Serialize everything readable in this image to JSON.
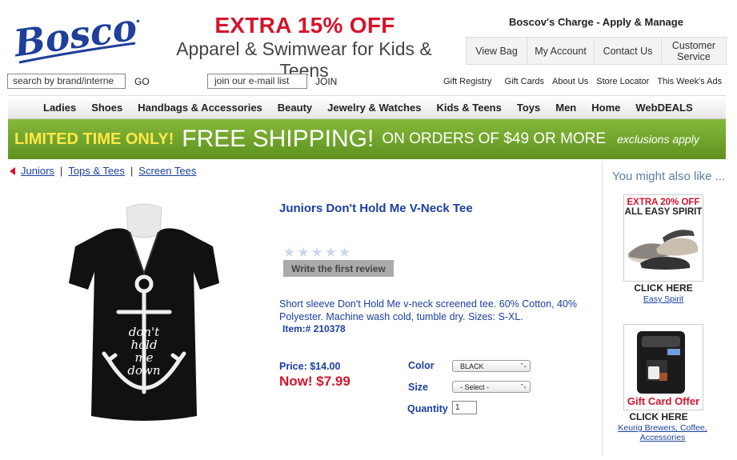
{
  "header": {
    "logo_text": "Boscov's",
    "promo_headline": "EXTRA 15% OFF",
    "promo_subline": "Apparel & Swimwear for Kids & Teens",
    "charge_link": "Boscov's Charge - Apply & Manage",
    "account_buttons": [
      "View Bag",
      "My Account",
      "Contact Us",
      "Customer Service"
    ],
    "search_value": "search by brand/interne",
    "go_label": "GO",
    "email_value": "join our e-mail list",
    "join_label": "JOIN",
    "utility_links": [
      "Gift Registry",
      "Gift Cards",
      "About Us",
      "Store Locator",
      "This Week's Ads"
    ]
  },
  "nav": {
    "items": [
      "Ladies",
      "Shoes",
      "Handbags & Accessories",
      "Beauty",
      "Jewelry & Watches",
      "Kids & Teens",
      "Toys",
      "Men",
      "Home",
      "WebDEALS"
    ]
  },
  "banner": {
    "limited": "LIMITED TIME ONLY!",
    "free_shipping": "FREE SHIPPING!",
    "orders": "ON ORDERS OF $49 OR MORE",
    "exclusions": "exclusions apply"
  },
  "breadcrumb": [
    "Juniors",
    "Tops & Tees",
    "Screen Tees"
  ],
  "breadcrumb_sep": "|",
  "product": {
    "title": "Juniors Don't Hold Me V-Neck Tee",
    "shirt_print": [
      "don't",
      "hold",
      "me",
      "down"
    ],
    "rating_stars": 0,
    "review_button": "Write the first review",
    "description": "Short sleeve Don't Hold Me v-neck screened tee. 60% Cotton, 40% Polyester. Machine wash cold, tumble dry. Sizes: S-XL.",
    "item_number": "Item:# 210378",
    "price": "Price: $14.00",
    "now_price": "Now! $7.99",
    "color_label": "Color",
    "color_value": "BLACK",
    "size_label": "Size",
    "size_value": "- Select -",
    "quantity_label": "Quantity",
    "quantity_value": "1"
  },
  "sidebar": {
    "heading": "You might also like ...",
    "ads": [
      {
        "headline1": "EXTRA 20% OFF",
        "headline2": "ALL EASY SPIRIT",
        "cta": "CLICK HERE",
        "link": "Easy Spirit"
      },
      {
        "headline1": "Gift Card Offer",
        "cta": "CLICK HERE",
        "link": "Keurig Brewers, Coffee, Accessories"
      }
    ]
  },
  "colors": {
    "accent_red": "#d4142b",
    "link_blue": "#1a3f9e",
    "banner_green": "#6fa52a",
    "banner_yellow": "#ffe84a"
  }
}
